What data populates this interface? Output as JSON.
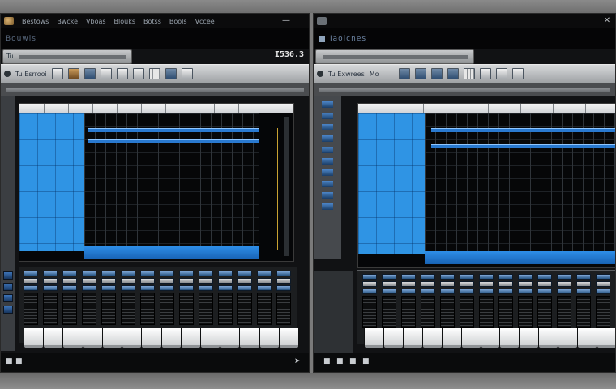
{
  "left_window": {
    "menu": [
      "Bestows",
      "Bwcke",
      "Vboas",
      "Blouks",
      "Botss",
      "Bools",
      "Vccee"
    ],
    "subtitle": "Bouwis",
    "time": "I536.3",
    "toolbar_label": "Tu Esrrooi",
    "subtab_label": "Tu"
  },
  "right_window": {
    "title": "Iaoicnes",
    "toolbar_label": "Tu Exwrees",
    "toolbar_label2": "Mo"
  },
  "colors": {
    "accent_blue": "#2f94e4",
    "background": "#111214",
    "toolbar": "#c7c9cb"
  }
}
